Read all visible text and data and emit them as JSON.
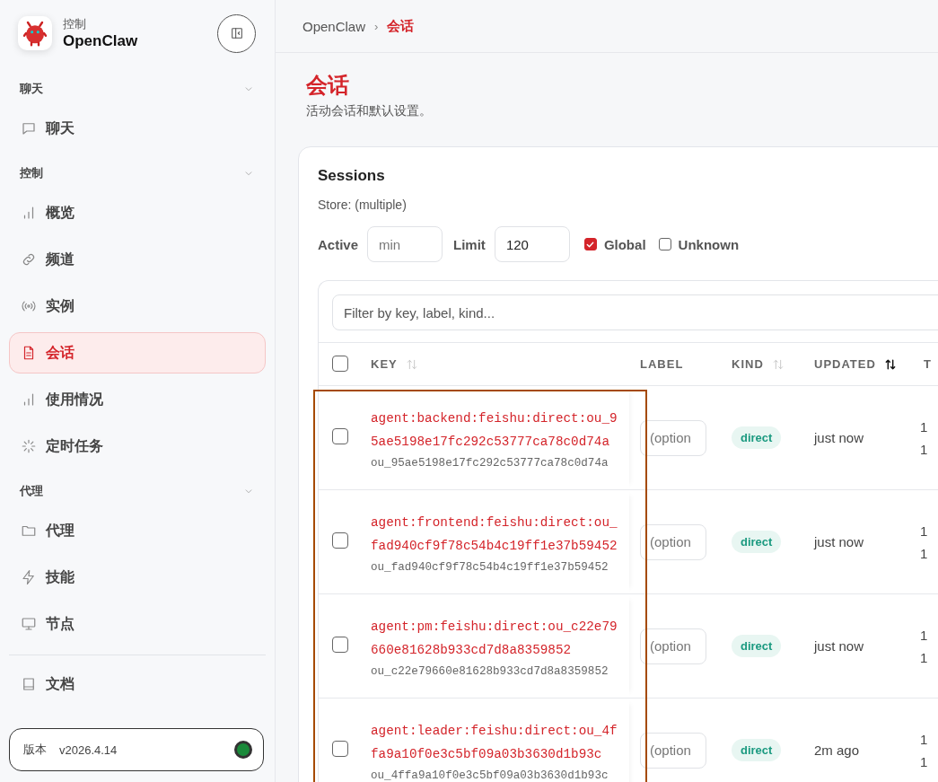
{
  "brand": {
    "subtitle": "控制",
    "title": "OpenClaw"
  },
  "sidebar": {
    "groups": [
      {
        "label": "聊天",
        "expanded": true,
        "items": [
          {
            "label": "聊天",
            "selected": false
          }
        ]
      },
      {
        "label": "控制",
        "expanded": true,
        "items": [
          {
            "label": "概览",
            "selected": false
          },
          {
            "label": "频道",
            "selected": false
          },
          {
            "label": "实例",
            "selected": false
          },
          {
            "label": "会话",
            "selected": true
          },
          {
            "label": "使用情况",
            "selected": false
          },
          {
            "label": "定时任务",
            "selected": false
          }
        ]
      },
      {
        "label": "代理",
        "expanded": true,
        "items": [
          {
            "label": "代理",
            "selected": false
          },
          {
            "label": "技能",
            "selected": false
          },
          {
            "label": "节点",
            "selected": false
          }
        ]
      }
    ],
    "footer_items": [
      {
        "label": "文档",
        "selected": false
      }
    ],
    "version": {
      "label": "版本",
      "value": "v2026.4.14",
      "online": true
    }
  },
  "breadcrumb": {
    "separator": "›",
    "items": [
      {
        "label": "OpenClaw",
        "current": false
      },
      {
        "label": "会话",
        "current": true
      }
    ]
  },
  "page": {
    "title": "会话",
    "subtitle": "活动会话和默认设置。"
  },
  "sessions": {
    "title": "Sessions",
    "store": "Store: (multiple)",
    "filters": [
      {
        "kind": "field",
        "label": "Active",
        "placeholder": "min"
      },
      {
        "kind": "field",
        "label": "Limit",
        "value": "120"
      },
      {
        "kind": "checkbox",
        "label": "Global",
        "checked": true
      },
      {
        "kind": "checkbox",
        "label": "Unknown",
        "checked": false
      }
    ],
    "search": {
      "placeholder": "Filter by key, label, kind..."
    },
    "select_all": {
      "checked": false
    },
    "columns": [
      {
        "label": "KEY",
        "sorted": false
      },
      {
        "label": "LABEL"
      },
      {
        "label": "KIND",
        "sorted": false
      },
      {
        "label": "UPDATED",
        "sorted": true
      },
      {
        "label": "T"
      }
    ],
    "rows": [
      {
        "selected": false,
        "key": "agent:backend:feishu:direct:ou_95ae5198e17fc292c53777ca78c0d74a",
        "sub": "ou_95ae5198e17fc292c53777ca78c0d74a",
        "label_placeholder": "(option",
        "kind": "direct",
        "updated": "just now",
        "column_5": [
          "1",
          "1"
        ]
      },
      {
        "selected": false,
        "key": "agent:frontend:feishu:direct:ou_fad940cf9f78c54b4c19ff1e37b59452",
        "sub": "ou_fad940cf9f78c54b4c19ff1e37b59452",
        "label_placeholder": "(option",
        "kind": "direct",
        "updated": "just now",
        "column_5": [
          "1",
          "1"
        ]
      },
      {
        "selected": false,
        "key": "agent:pm:feishu:direct:ou_c22e79660e81628b933cd7d8a8359852",
        "sub": "ou_c22e79660e81628b933cd7d8a8359852",
        "label_placeholder": "(option",
        "kind": "direct",
        "updated": "just now",
        "column_5": [
          "1",
          "1"
        ]
      },
      {
        "selected": false,
        "key": "agent:leader:feishu:direct:ou_4ffa9a10f0e3c5bf09a03b3630d1b93c",
        "sub": "ou_4ffa9a10f0e3c5bf09a03b3630d1b93c",
        "label_placeholder": "(option",
        "kind": "direct",
        "updated": "2m ago",
        "column_5": [
          "1",
          "1"
        ]
      }
    ]
  }
}
